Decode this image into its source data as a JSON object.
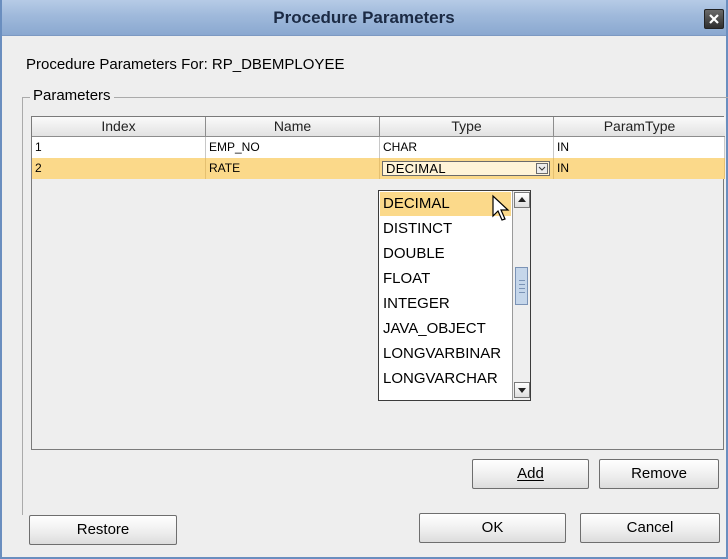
{
  "window": {
    "title": "Procedure Parameters",
    "close_icon": "close-icon"
  },
  "header": {
    "for_label": "Procedure Parameters For:  RP_DBEMPLOYEE"
  },
  "group": {
    "label": "Parameters"
  },
  "table": {
    "columns": [
      "Index",
      "Name",
      "Type",
      "ParamType"
    ],
    "rows": [
      {
        "index": "1",
        "name": "EMP_NO",
        "type": "CHAR",
        "param_type": "IN"
      },
      {
        "index": "2",
        "name": "RATE",
        "type": "DECIMAL",
        "param_type": "IN"
      }
    ],
    "selected_row_color": "#fbd98a"
  },
  "dropdown": {
    "items": [
      "DECIMAL",
      "DISTINCT",
      "DOUBLE",
      "FLOAT",
      "INTEGER",
      "JAVA_OBJECT",
      "LONGVARBINAR",
      "LONGVARCHAR"
    ],
    "selected": "DECIMAL"
  },
  "buttons": {
    "add": "Add",
    "remove": "Remove",
    "restore": "Restore",
    "ok": "OK",
    "cancel": "Cancel"
  }
}
